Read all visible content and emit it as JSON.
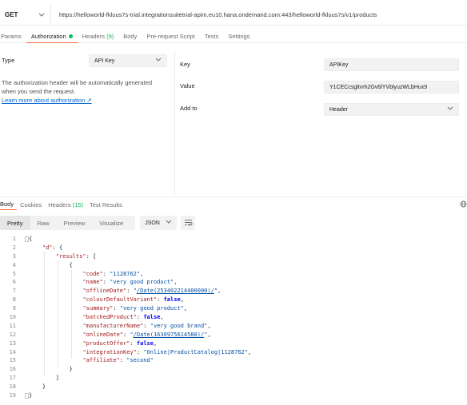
{
  "request": {
    "method": "GET",
    "url": "https://helloworld-fkluus7s-trial.integrationsuitetrial-apim.eu10.hana.ondemand.com:443/helloworld-fkluus7s/v1/products"
  },
  "request_tabs": [
    {
      "label": "Params",
      "count": ""
    },
    {
      "label": "Authorization",
      "count": ""
    },
    {
      "label": "Headers",
      "count": "(9)"
    },
    {
      "label": "Body",
      "count": ""
    },
    {
      "label": "Pre-request Script",
      "count": ""
    },
    {
      "label": "Tests",
      "count": ""
    },
    {
      "label": "Settings",
      "count": ""
    }
  ],
  "auth": {
    "type_label": "Type",
    "type_value": "API Key",
    "description": "The authorization header will be automatically generated when you send the request.",
    "link": "Learn more about authorization ↗",
    "key_label": "Key",
    "key_value": "APIKey",
    "value_label": "Value",
    "value_value": "Y1CECcsgltvrh2Gv6lYVblyuzWLbHux9",
    "addto_label": "Add to",
    "addto_value": "Header"
  },
  "response_tabs": [
    {
      "label": "Body",
      "count": ""
    },
    {
      "label": "Cookies",
      "count": ""
    },
    {
      "label": "Headers",
      "count": "(15)"
    },
    {
      "label": "Test Results",
      "count": ""
    }
  ],
  "format_tabs": [
    "Pretty",
    "Raw",
    "Preview",
    "Visualize"
  ],
  "format_select": "JSON",
  "code_lines": [
    [
      {
        "t": "{",
        "c": "p"
      }
    ],
    [
      {
        "t": "    ",
        "c": "p"
      },
      {
        "t": "\"d\"",
        "c": "k"
      },
      {
        "t": ": {",
        "c": "p"
      }
    ],
    [
      {
        "t": "        ",
        "c": "p"
      },
      {
        "t": "\"results\"",
        "c": "k"
      },
      {
        "t": ": [",
        "c": "p"
      }
    ],
    [
      {
        "t": "            {",
        "c": "p"
      }
    ],
    [
      {
        "t": "                ",
        "c": "p"
      },
      {
        "t": "\"code\"",
        "c": "k"
      },
      {
        "t": ": ",
        "c": "p"
      },
      {
        "t": "\"1128762\"",
        "c": "s"
      },
      {
        "t": ",",
        "c": "p"
      }
    ],
    [
      {
        "t": "                ",
        "c": "p"
      },
      {
        "t": "\"name\"",
        "c": "k"
      },
      {
        "t": ": ",
        "c": "p"
      },
      {
        "t": "\"very good product\"",
        "c": "s"
      },
      {
        "t": ",",
        "c": "p"
      }
    ],
    [
      {
        "t": "                ",
        "c": "p"
      },
      {
        "t": "\"offlineDate\"",
        "c": "k"
      },
      {
        "t": ": ",
        "c": "p"
      },
      {
        "t": "\"",
        "c": "s"
      },
      {
        "t": "/Date(253402214400000)/",
        "c": "lnk"
      },
      {
        "t": "\"",
        "c": "s"
      },
      {
        "t": ",",
        "c": "p"
      }
    ],
    [
      {
        "t": "                ",
        "c": "p"
      },
      {
        "t": "\"colourDefaultVariant\"",
        "c": "k"
      },
      {
        "t": ": ",
        "c": "p"
      },
      {
        "t": "false",
        "c": "b"
      },
      {
        "t": ",",
        "c": "p"
      }
    ],
    [
      {
        "t": "                ",
        "c": "p"
      },
      {
        "t": "\"summary\"",
        "c": "k"
      },
      {
        "t": ": ",
        "c": "p"
      },
      {
        "t": "\"very good product\"",
        "c": "s"
      },
      {
        "t": ",",
        "c": "p"
      }
    ],
    [
      {
        "t": "                ",
        "c": "p"
      },
      {
        "t": "\"batchedProduct\"",
        "c": "k"
      },
      {
        "t": ": ",
        "c": "p"
      },
      {
        "t": "false",
        "c": "b"
      },
      {
        "t": ",",
        "c": "p"
      }
    ],
    [
      {
        "t": "                ",
        "c": "p"
      },
      {
        "t": "\"manufacturerName\"",
        "c": "k"
      },
      {
        "t": ": ",
        "c": "p"
      },
      {
        "t": "\"very good brand\"",
        "c": "s"
      },
      {
        "t": ",",
        "c": "p"
      }
    ],
    [
      {
        "t": "                ",
        "c": "p"
      },
      {
        "t": "\"onlineDate\"",
        "c": "k"
      },
      {
        "t": ": ",
        "c": "p"
      },
      {
        "t": "\"",
        "c": "s"
      },
      {
        "t": "/Date(1630975614588)/",
        "c": "lnk"
      },
      {
        "t": "\"",
        "c": "s"
      },
      {
        "t": ",",
        "c": "p"
      }
    ],
    [
      {
        "t": "                ",
        "c": "p"
      },
      {
        "t": "\"productOffer\"",
        "c": "k"
      },
      {
        "t": ": ",
        "c": "p"
      },
      {
        "t": "false",
        "c": "b"
      },
      {
        "t": ",",
        "c": "p"
      }
    ],
    [
      {
        "t": "                ",
        "c": "p"
      },
      {
        "t": "\"integrationKey\"",
        "c": "k"
      },
      {
        "t": ": ",
        "c": "p"
      },
      {
        "t": "\"Online|ProductCatalog|1128762\"",
        "c": "s"
      },
      {
        "t": ",",
        "c": "p"
      }
    ],
    [
      {
        "t": "                ",
        "c": "p"
      },
      {
        "t": "\"affiliate\"",
        "c": "k"
      },
      {
        "t": ": ",
        "c": "p"
      },
      {
        "t": "\"second\"",
        "c": "s"
      }
    ],
    [
      {
        "t": "            }",
        "c": "p"
      }
    ],
    [
      {
        "t": "        ]",
        "c": "p"
      }
    ],
    [
      {
        "t": "    }",
        "c": "p"
      }
    ],
    [
      {
        "t": "}",
        "c": "p"
      }
    ]
  ],
  "colors": {
    "accent": "#ff6c37",
    "success": "#0cbb52",
    "link": "#0265d2"
  }
}
